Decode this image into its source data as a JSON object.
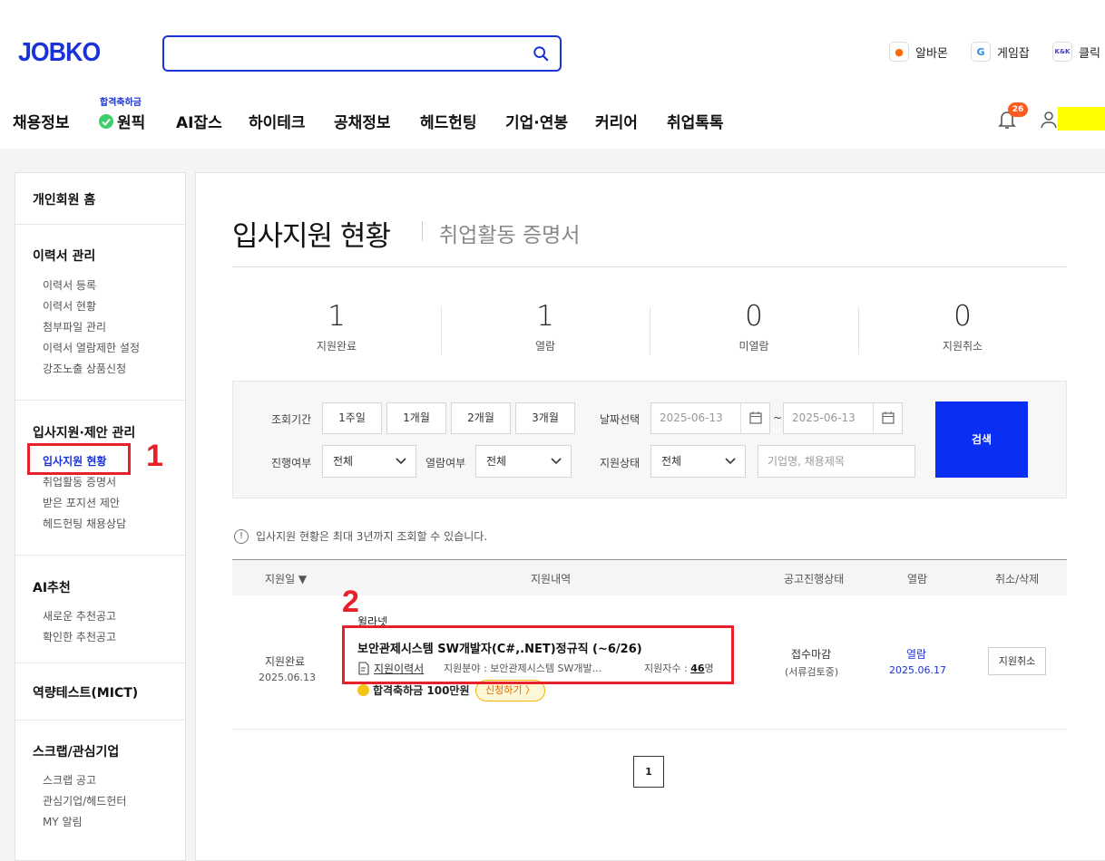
{
  "header": {
    "logo": "JOBKO",
    "family_sites": [
      {
        "label": "알바몬",
        "icon": "albamon-icon",
        "color": "#ff6a00"
      },
      {
        "label": "게임잡",
        "icon": "gamejob-icon",
        "color": "#2a8ce6"
      },
      {
        "label": "클릭",
        "icon": "klik-icon",
        "color": "#3b3bd6"
      }
    ],
    "gnb": [
      "채용정보",
      "원픽",
      "AI잡스",
      "하이테크",
      "공채정보",
      "헤드헌팅",
      "기업·연봉",
      "커리어",
      "취업톡톡"
    ],
    "onepick_badge": "합격축하금",
    "notification_count": "26"
  },
  "sidebar": {
    "home": "개인회원 홈",
    "sections": [
      {
        "title": "이력서 관리",
        "items": [
          "이력서 등록",
          "이력서 현황",
          "첨부파일 관리",
          "이력서 열람제한 설정",
          "강조노출 상품신청"
        ]
      },
      {
        "title": "입사지원·제안 관리",
        "items": [
          "입사지원 현황",
          "취업활동 증명서",
          "받은 포지션 제안",
          "헤드헌팅 채용상담"
        ]
      },
      {
        "title": "AI추천",
        "items": [
          "새로운 추천공고",
          "확인한 추천공고"
        ]
      },
      {
        "title": "역량테스트(MICT)",
        "items": []
      },
      {
        "title": "스크랩/관심기업",
        "items": [
          "스크랩 공고",
          "관심기업/헤드헌터",
          "MY 알림"
        ]
      }
    ]
  },
  "main": {
    "title": "입사지원 현황",
    "subtitle": "취업활동 증명서",
    "stats": [
      {
        "value": "1",
        "label": "지원완료"
      },
      {
        "value": "1",
        "label": "열람"
      },
      {
        "value": "0",
        "label": "미열람"
      },
      {
        "value": "0",
        "label": "지원취소"
      }
    ],
    "filter": {
      "period_label": "조회기간",
      "periods": [
        "1주일",
        "1개월",
        "2개월",
        "3개월"
      ],
      "date_label": "날짜선택",
      "date_from": "2025-06-13",
      "date_sep": "~",
      "date_to": "2025-06-13",
      "progress_label": "진행여부",
      "progress_value": "전체",
      "read_label": "열람여부",
      "read_value": "전체",
      "status_label": "지원상태",
      "status_value": "전체",
      "keyword_placeholder": "기업명, 채용제목",
      "search_button": "검색"
    },
    "notice": "입사지원 현황은 최대 3년까지 조회할 수 있습니다.",
    "table": {
      "headers": [
        "지원일 ▼",
        "지원내역",
        "공고진행상태",
        "열람",
        "취소/삭제"
      ],
      "row": {
        "status": "지원완료",
        "date": "2025.06.13",
        "company": "윌라넷",
        "title": "보안관제시스템 SW개발자(C#,.NET)정규직 (~6/26)",
        "resume_link": "지원이력서",
        "field": "지원분야 : 보안관제시스템 SW개발...",
        "applicants_label": "지원자수 :",
        "applicants": "46",
        "applicants_unit": "명",
        "bonus": "합격축하금 100만원",
        "apply_button": "신청하기 〉",
        "progress_status": "접수마감",
        "progress_sub": "(서류검토중)",
        "read_status": "열람",
        "read_date": "2025.06.17",
        "cancel_button": "지원취소"
      }
    },
    "pagination": [
      "1"
    ]
  },
  "annotations": [
    "1",
    "2"
  ]
}
